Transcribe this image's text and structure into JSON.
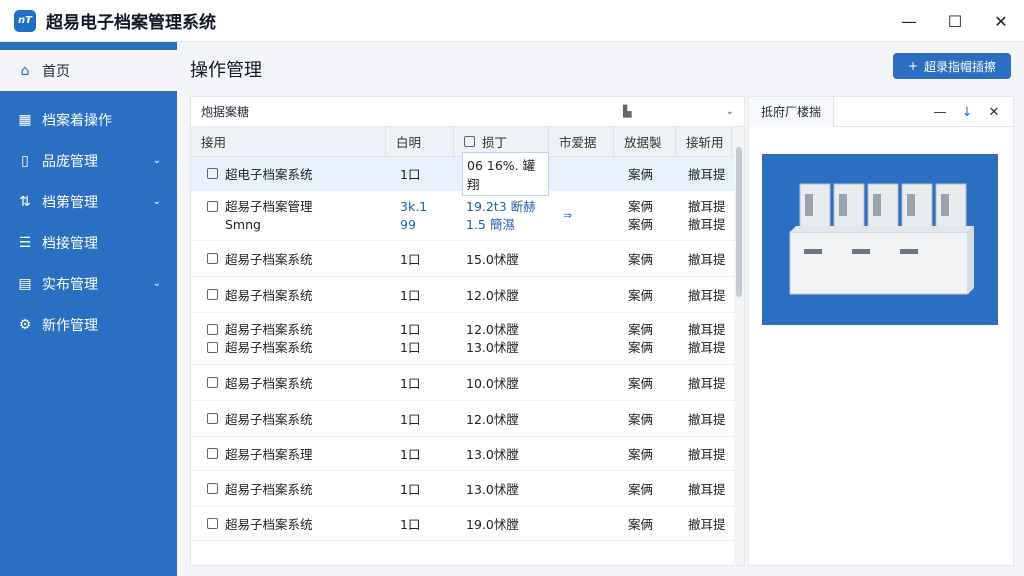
{
  "app": {
    "title": "超易电子档案管理系统",
    "logo_text": "nT",
    "window_controls": {
      "minimize": "—",
      "maximize": "☐",
      "close": "✕"
    }
  },
  "sidebar": {
    "items": [
      {
        "label": "首页",
        "icon": "home-icon",
        "glyph": "⌂",
        "active": true,
        "expandable": false
      },
      {
        "label": "档案着操作",
        "icon": "grid-icon",
        "glyph": "▦",
        "active": false,
        "expandable": false
      },
      {
        "label": "品庞管理",
        "icon": "document-icon",
        "glyph": "▯",
        "active": false,
        "expandable": true
      },
      {
        "label": "档第管理",
        "icon": "flow-icon",
        "glyph": "⇅",
        "active": false,
        "expandable": true
      },
      {
        "label": "档接管理",
        "icon": "list-icon",
        "glyph": "☰",
        "active": false,
        "expandable": false
      },
      {
        "label": "实布管理",
        "icon": "report-icon",
        "glyph": "▤",
        "active": false,
        "expandable": true
      },
      {
        "label": "新作管理",
        "icon": "gear-icon",
        "glyph": "⚙",
        "active": false,
        "expandable": false
      }
    ]
  },
  "main": {
    "page_title": "操作管理",
    "top_button": {
      "label": "超录指帽插擦",
      "icon": "plus-icon"
    },
    "filter": {
      "label": "炮据案糖",
      "mid_icon": "doc-small-icon"
    },
    "columns": [
      "接用",
      "白明",
      "损丁",
      "市爱据",
      "放据製",
      "接斩用"
    ],
    "rows": [
      {
        "name": "超电子档案系统",
        "sub": "",
        "c2": "1口",
        "c2b": "",
        "c3": "06 16%. 罐翔",
        "c3b": "",
        "c4": "",
        "c5": "案俩",
        "c6": "撤耳提",
        "c5b": "",
        "c6b": "",
        "selected": true
      },
      {
        "name": "超易子档案管理",
        "sub": "Smng",
        "c2": "3k.1",
        "c2b": "99",
        "c3": "19.2t3 断赫",
        "c3b": "1.5 簡濕",
        "c4": "⇒",
        "c5": "案俩",
        "c6": "撤耳提",
        "c5b": "案俩",
        "c6b": "撤耳提",
        "selected": false
      },
      {
        "name": "超易子档案系统",
        "sub": "",
        "c2": "1口",
        "c2b": "",
        "c3": "15.0怵膛",
        "c3b": "",
        "c4": "",
        "c5": "案俩",
        "c6": "撤耳提",
        "c5b": "",
        "c6b": "",
        "selected": false
      },
      {
        "name": "超易子档案系统",
        "sub": "",
        "c2": "1口",
        "c2b": "",
        "c3": "12.0怵膛",
        "c3b": "",
        "c4": "",
        "c5": "案俩",
        "c6": "撤耳提",
        "c5b": "",
        "c6b": "",
        "selected": false
      },
      {
        "name": "超易子档案系统",
        "sub": "超易子档案系统",
        "c2": "1口",
        "c2b": "1口",
        "c3": "12.0怵膛",
        "c3b": "13.0怵膛",
        "c4": "",
        "c5": "案俩",
        "c6": "撤耳提",
        "c5b": "案俩",
        "c6b": "撤耳提",
        "selected": false
      },
      {
        "name": "超易子档案系统",
        "sub": "",
        "c2": "1口",
        "c2b": "",
        "c3": "10.0怵膛",
        "c3b": "",
        "c4": "",
        "c5": "案俩",
        "c6": "撤耳提",
        "c5b": "",
        "c6b": "",
        "selected": false
      },
      {
        "name": "超易子档案系统",
        "sub": "",
        "c2": "1口",
        "c2b": "",
        "c3": "12.0怵膛",
        "c3b": "",
        "c4": "",
        "c5": "案俩",
        "c6": "撤耳提",
        "c5b": "",
        "c6b": "",
        "selected": false
      },
      {
        "name": "超易子档案系理",
        "sub": "",
        "c2": "1口",
        "c2b": "",
        "c3": "13.0怵膛",
        "c3b": "",
        "c4": "",
        "c5": "案俩",
        "c6": "撤耳提",
        "c5b": "",
        "c6b": "",
        "selected": false
      },
      {
        "name": "超易子档案系统",
        "sub": "",
        "c2": "1口",
        "c2b": "",
        "c3": "13.0怵膛",
        "c3b": "",
        "c4": "",
        "c5": "案俩",
        "c6": "撤耳提",
        "c5b": "",
        "c6b": "",
        "selected": false
      },
      {
        "name": "超易子档案系统",
        "sub": "",
        "c2": "1口",
        "c2b": "",
        "c3": "19.0怵膛",
        "c3b": "",
        "c4": "",
        "c5": "案俩",
        "c6": "撤耳提",
        "c5b": "",
        "c6b": "",
        "selected": false
      }
    ]
  },
  "preview": {
    "tab_label": "抵府厂楼揣",
    "controls": {
      "minimize": "—",
      "pin": "↓",
      "close": "✕"
    },
    "image": "archive-boxes-image"
  },
  "colors": {
    "accent": "#2a6fc2",
    "sidebar": "#2a6fc2",
    "selected_row": "#e8f1fc"
  }
}
